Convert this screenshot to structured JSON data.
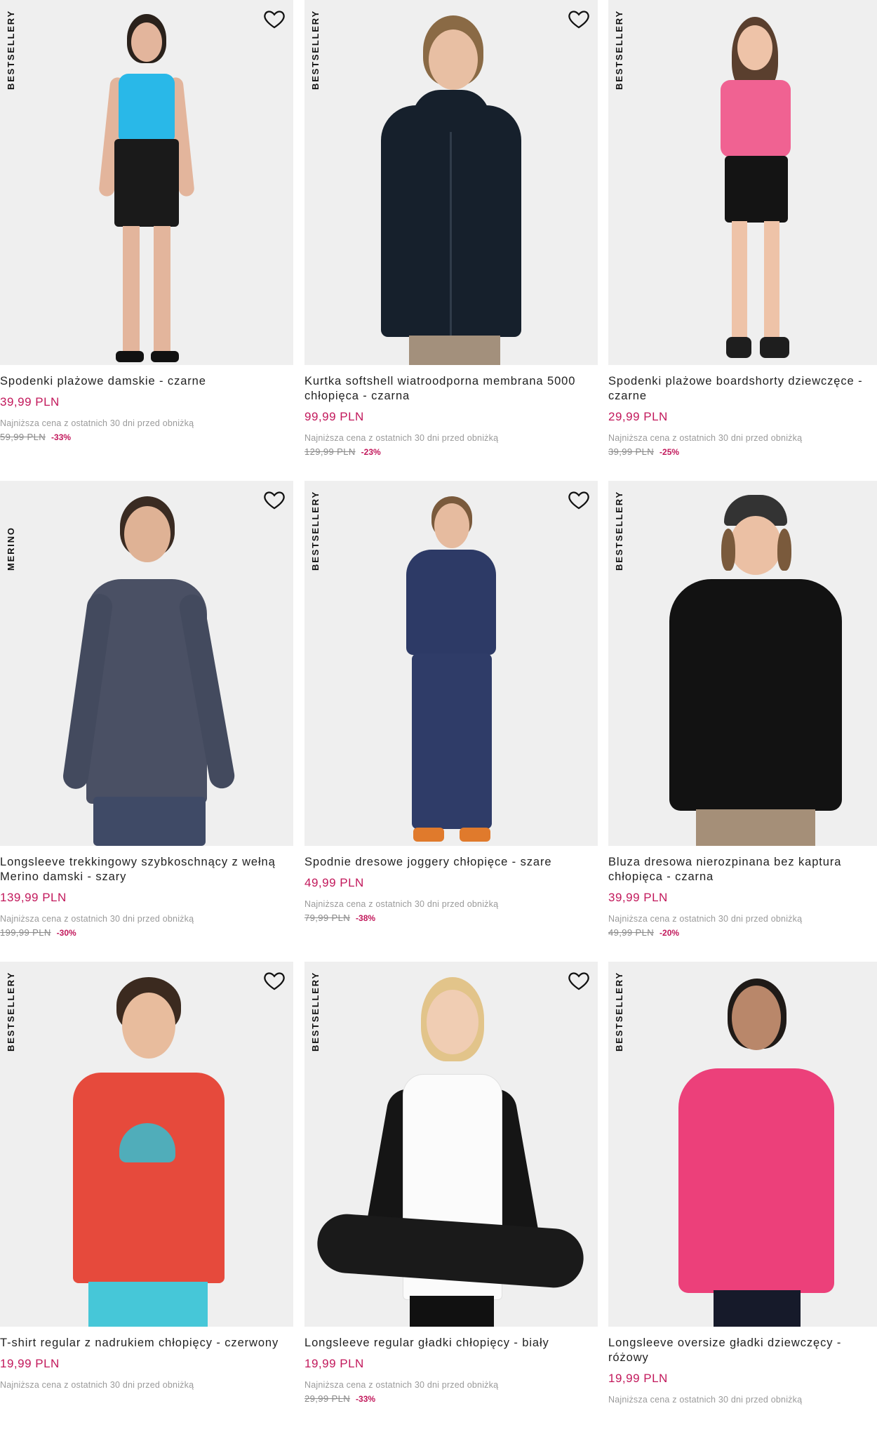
{
  "products": [
    {
      "badge": "BESTSELLERY",
      "name": "Spodenki plażowe damskie - czarne",
      "price": "39,99 PLN",
      "lowest_label": "Najniższa cena z ostatnich 30 dni przed obniżką",
      "old_price": "59,99 PLN",
      "discount": "-33%"
    },
    {
      "badge": "BESTSELLERY",
      "name": "Kurtka softshell wiatroodporna membrana 5000 chłopięca - czarna",
      "price": "99,99 PLN",
      "lowest_label": "Najniższa cena z ostatnich 30 dni przed obniżką",
      "old_price": "129,99 PLN",
      "discount": "-23%"
    },
    {
      "badge": "BESTSELLERY",
      "name": "Spodenki plażowe boardshorty dziewczęce - czarne",
      "price": "29,99 PLN",
      "lowest_label": "Najniższa cena z ostatnich 30 dni przed obniżką",
      "old_price": "39,99 PLN",
      "discount": "-25%"
    },
    {
      "badge": "MERINO",
      "name": "Longsleeve trekkingowy szybkoschnący z wełną Merino damski - szary",
      "price": "139,99 PLN",
      "lowest_label": "Najniższa cena z ostatnich 30 dni przed obniżką",
      "old_price": "199,99 PLN",
      "discount": "-30%"
    },
    {
      "badge": "BESTSELLERY",
      "name": "Spodnie dresowe joggery chłopięce - szare",
      "price": "49,99 PLN",
      "lowest_label": "Najniższa cena z ostatnich 30 dni przed obniżką",
      "old_price": "79,99 PLN",
      "discount": "-38%"
    },
    {
      "badge": "BESTSELLERY",
      "name": "Bluza dresowa nierozpinana bez kaptura chłopięca - czarna",
      "price": "39,99 PLN",
      "lowest_label": "Najniższa cena z ostatnich 30 dni przed obniżką",
      "old_price": "49,99 PLN",
      "discount": "-20%"
    },
    {
      "badge": "BESTSELLERY",
      "name": "T-shirt regular z nadrukiem chłopięcy - czerwony",
      "price": "19,99 PLN",
      "lowest_label": "Najniższa cena z ostatnich 30 dni przed obniżką",
      "old_price": "",
      "discount": ""
    },
    {
      "badge": "BESTSELLERY",
      "name": "Longsleeve regular gładki chłopięcy - biały",
      "price": "19,99 PLN",
      "lowest_label": "Najniższa cena z ostatnich 30 dni przed obniżką",
      "old_price": "29,99 PLN",
      "discount": "-33%"
    },
    {
      "badge": "BESTSELLERY",
      "name": "Longsleeve oversize gładki dziewczęcy - różowy",
      "price": "19,99 PLN",
      "lowest_label": "Najniższa cena z ostatnich 30 dni przed obniżką",
      "old_price": "",
      "discount": ""
    }
  ],
  "colors": {
    "price": "#c2185b",
    "image_background": "#efefef",
    "text": "#222222",
    "muted": "#9a9a9a"
  },
  "icons": {
    "wishlist": "heart-outline-icon"
  }
}
